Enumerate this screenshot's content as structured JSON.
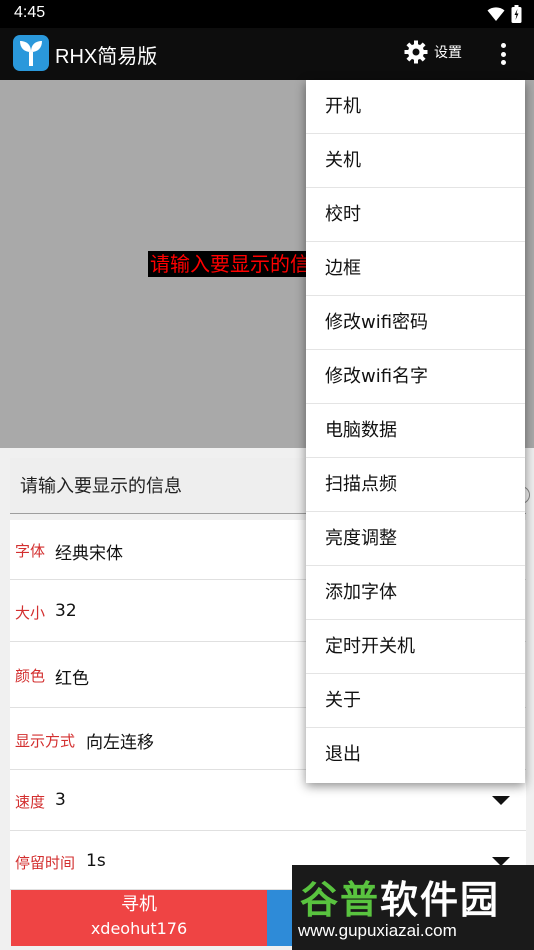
{
  "status_bar": {
    "time": "4:45"
  },
  "app_bar": {
    "title": "RHX简易版",
    "settings_label": "设置"
  },
  "preview": {
    "text": "请输入要显示的信息"
  },
  "input": {
    "placeholder": "请输入要显示的信息"
  },
  "settings": [
    {
      "key": "字体",
      "value": "经典宋体"
    },
    {
      "key": "大小",
      "value": "32"
    },
    {
      "key": "颜色",
      "value": "红色"
    },
    {
      "key": "显示方式",
      "value": "向左连移"
    },
    {
      "key": "速度",
      "value": "3"
    },
    {
      "key": "停留时间",
      "value": "1s"
    }
  ],
  "buttons": {
    "find_label": "寻机",
    "find_device": "xdeohut176"
  },
  "menu": {
    "items": [
      {
        "label": "开机"
      },
      {
        "label": "关机"
      },
      {
        "label": "校时"
      },
      {
        "label": "边框"
      },
      {
        "label": "修改wifi密码"
      },
      {
        "label": "修改wifi名字"
      },
      {
        "label": "电脑数据"
      },
      {
        "label": "扫描点频"
      },
      {
        "label": "亮度调整"
      },
      {
        "label": "添加字体"
      },
      {
        "label": "定时开关机"
      },
      {
        "label": "关于"
      },
      {
        "label": "退出"
      }
    ]
  },
  "watermark": {
    "brand": "谷普软件园",
    "url": "www.gupuxiazai.com"
  },
  "colors": {
    "accent_red": "#ef4444",
    "accent_blue": "#2e8bd8",
    "label_red": "#d32f2f",
    "preview_text": "#ff0000"
  }
}
